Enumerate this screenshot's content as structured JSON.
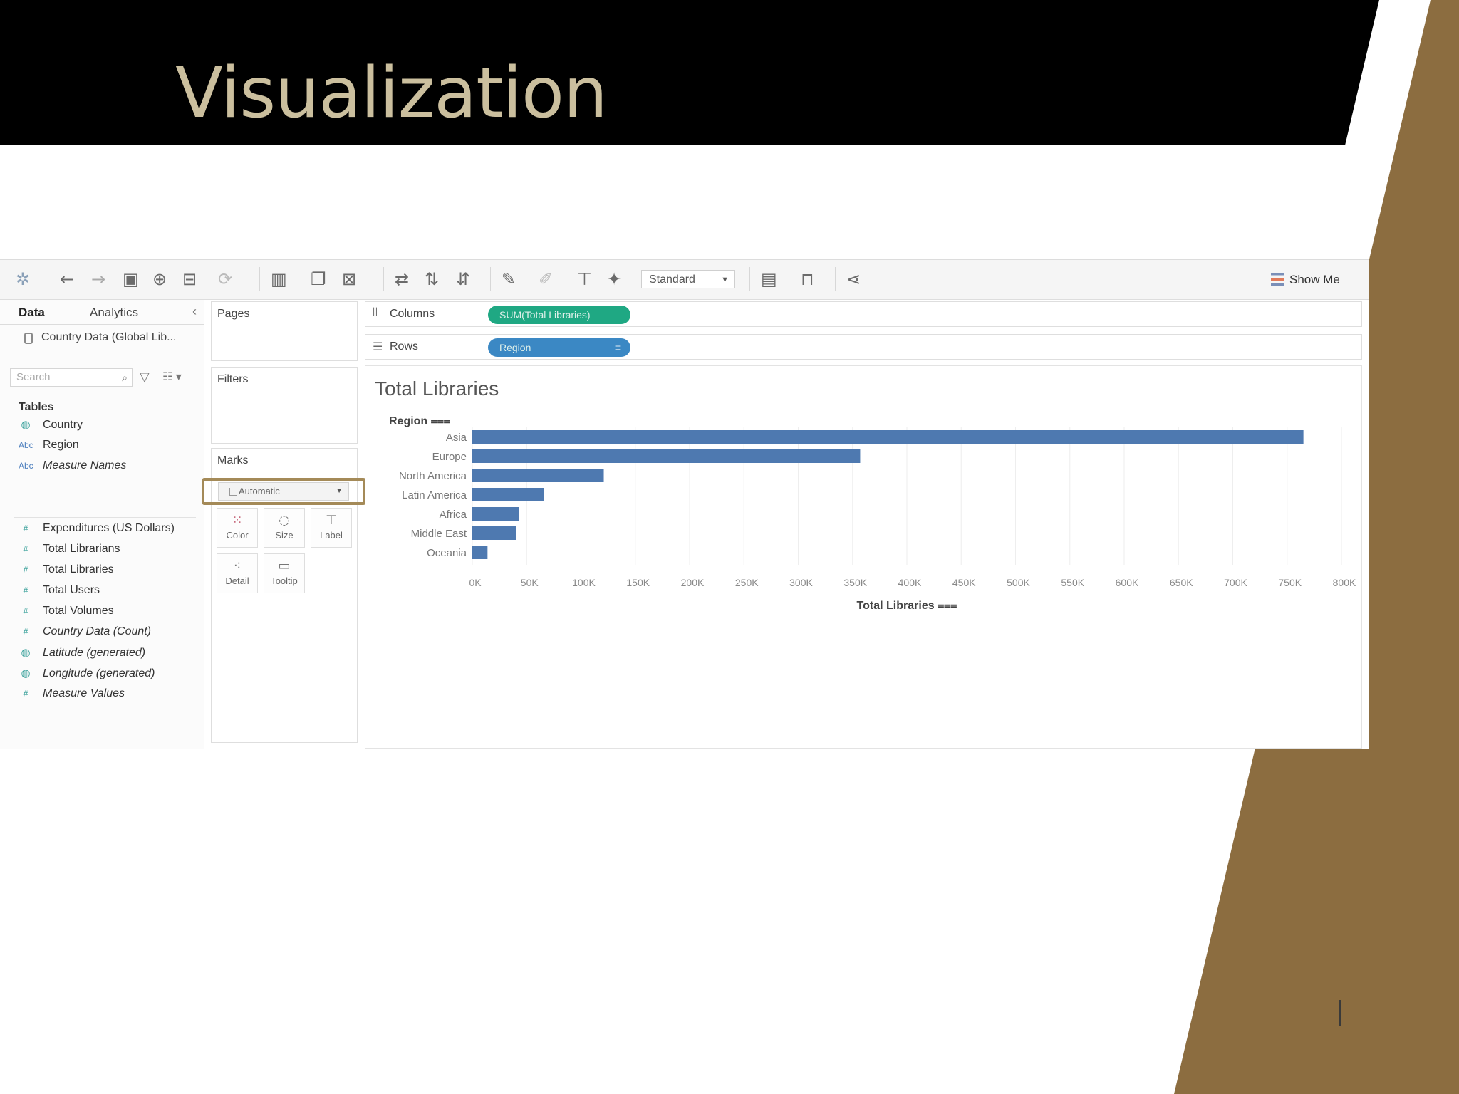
{
  "slide": {
    "title": "Visualization"
  },
  "toolbar": {
    "standard_label": "Standard",
    "show_me_label": "Show Me"
  },
  "left_pane": {
    "tab_data": "Data",
    "tab_analytics": "Analytics",
    "data_source": "Country Data (Global Lib...",
    "search_placeholder": "Search",
    "tables_header": "Tables",
    "fields": [
      {
        "type": "geo",
        "label": "Country",
        "italic": false
      },
      {
        "type": "Abc",
        "label": "Region",
        "italic": false
      },
      {
        "type": "Abc",
        "label": "Measure Names",
        "italic": true
      },
      {
        "type": "#",
        "label": "Expenditures  (US Dollars)",
        "italic": false
      },
      {
        "type": "#",
        "label": "Total Librarians",
        "italic": false
      },
      {
        "type": "#",
        "label": "Total Libraries",
        "italic": false
      },
      {
        "type": "#",
        "label": "Total Users",
        "italic": false
      },
      {
        "type": "#",
        "label": "Total Volumes",
        "italic": false
      },
      {
        "type": "#",
        "label": "Country Data (Count)",
        "italic": true
      },
      {
        "type": "geo",
        "label": "Latitude (generated)",
        "italic": true
      },
      {
        "type": "geo",
        "label": "Longitude (generated)",
        "italic": true
      },
      {
        "type": "#",
        "label": "Measure Values",
        "italic": true
      }
    ]
  },
  "cards": {
    "pages_title": "Pages",
    "filters_title": "Filters",
    "marks_title": "Marks",
    "marks_type": "Automatic",
    "mark_buttons": [
      "Color",
      "Size",
      "Label",
      "Detail",
      "Tooltip"
    ]
  },
  "shelves": {
    "columns_label": "Columns",
    "columns_pill": "SUM(Total Libraries)",
    "rows_label": "Rows",
    "rows_pill": "Region"
  },
  "chart_data": {
    "type": "bar",
    "orientation": "horizontal",
    "title": "Total Libraries",
    "categories_header": "Region",
    "categories": [
      "Asia",
      "Europe",
      "North America",
      "Latin America",
      "Africa",
      "Middle East",
      "Oceania"
    ],
    "values": [
      765000,
      357000,
      121000,
      66000,
      43000,
      40000,
      14000
    ],
    "xlabel": "Total Libraries",
    "xlim": [
      0,
      800000
    ],
    "xticks": [
      "0K",
      "50K",
      "100K",
      "150K",
      "200K",
      "250K",
      "300K",
      "350K",
      "400K",
      "450K",
      "500K",
      "550K",
      "600K",
      "650K",
      "700K",
      "750K",
      "800K"
    ],
    "bar_color": "#4e79b0",
    "grid": true
  },
  "colors": {
    "title_bar": "#000000",
    "title_text": "#cbbf9e",
    "accent_brown": "#8c6d40",
    "highlight_border": "#a48a58",
    "measure_pill": "#1fa883",
    "dimension_pill": "#3b88c4"
  }
}
